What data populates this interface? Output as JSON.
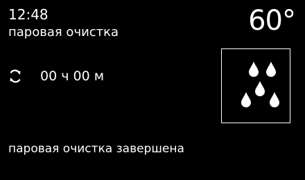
{
  "header": {
    "time": "12:48",
    "program": "паровая очистка",
    "temperature": "60°"
  },
  "timer": {
    "icon": "cycle-arrows-icon",
    "value": "00 ч 00 м"
  },
  "mode": {
    "icon": "steam-drops-icon"
  },
  "status": {
    "message": "паровая очистка завершена"
  },
  "colors": {
    "background": "#000000",
    "foreground": "#ffffff"
  }
}
